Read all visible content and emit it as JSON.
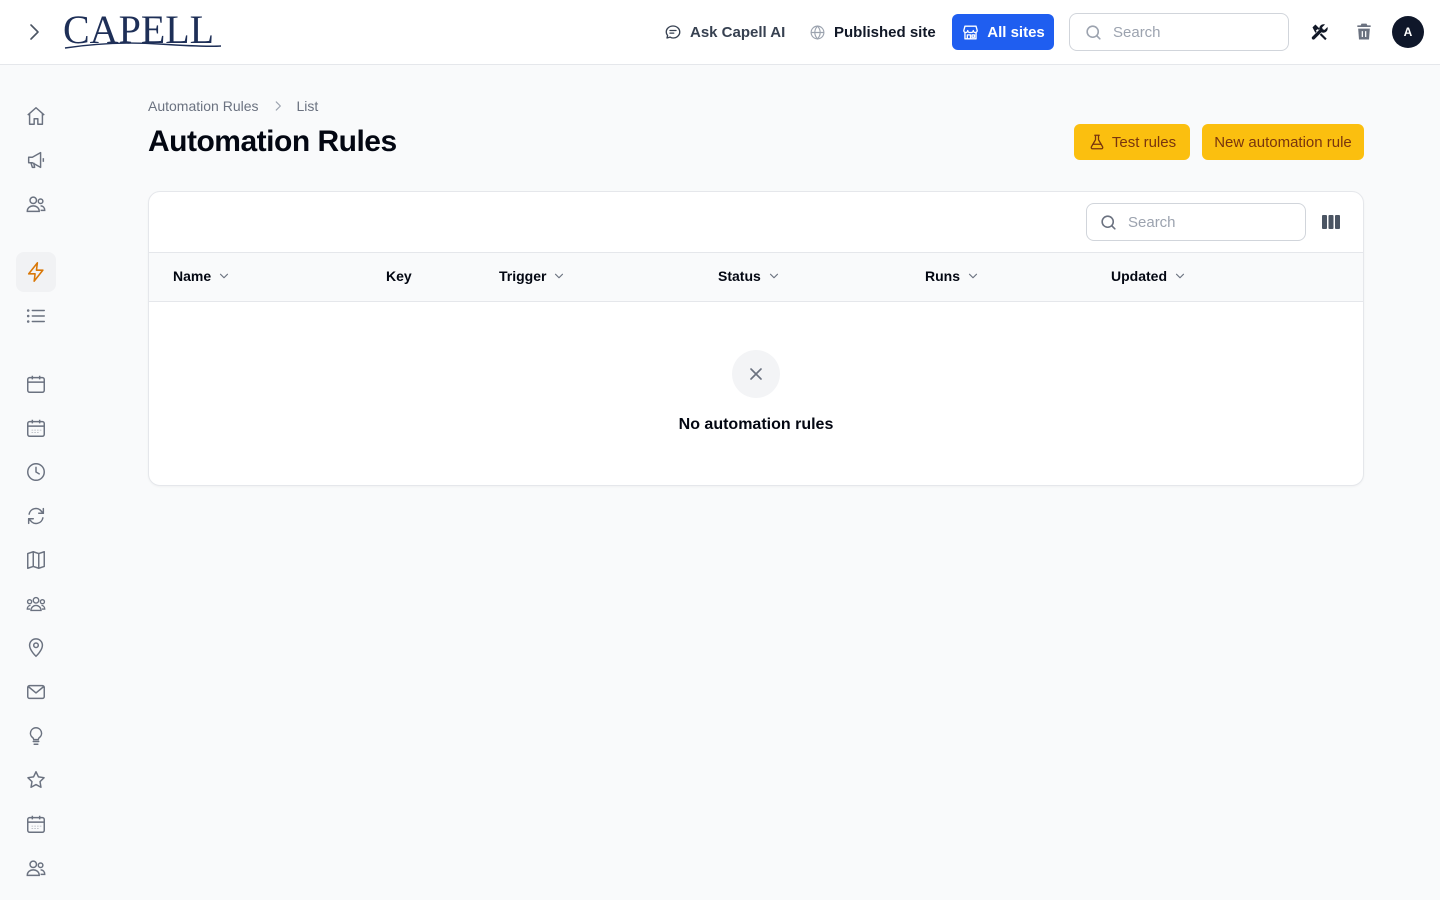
{
  "header": {
    "brand": "CAPELL",
    "ask_ai_label": "Ask Capell AI",
    "published_label": "Published site",
    "all_sites_label": "All sites",
    "search_placeholder": "Search",
    "avatar_initial": "A"
  },
  "sidebar": {
    "items": [
      {
        "icon": "home-icon"
      },
      {
        "icon": "megaphone-icon"
      },
      {
        "icon": "users-icon"
      },
      {
        "icon": "bolt-icon",
        "active": true
      },
      {
        "icon": "list-icon"
      },
      {
        "icon": "calendar-icon"
      },
      {
        "icon": "calendar-days-icon"
      },
      {
        "icon": "clock-icon"
      },
      {
        "icon": "refresh-icon"
      },
      {
        "icon": "map-icon"
      },
      {
        "icon": "user-group-icon"
      },
      {
        "icon": "map-pin-icon"
      },
      {
        "icon": "envelope-icon"
      },
      {
        "icon": "light-bulb-icon"
      },
      {
        "icon": "star-icon"
      },
      {
        "icon": "calendar-days-icon"
      },
      {
        "icon": "users-icon"
      }
    ]
  },
  "breadcrumb": {
    "items": [
      "Automation Rules",
      "List"
    ]
  },
  "page": {
    "title": "Automation Rules",
    "test_rules_label": "Test rules",
    "new_rule_label": "New automation rule"
  },
  "table": {
    "search_placeholder": "Search",
    "columns": [
      {
        "label": "Name",
        "sortable": true
      },
      {
        "label": "Key",
        "sortable": false
      },
      {
        "label": "Trigger",
        "sortable": true
      },
      {
        "label": "Status",
        "sortable": true
      },
      {
        "label": "Runs",
        "sortable": true
      },
      {
        "label": "Updated",
        "sortable": true
      }
    ],
    "rows": [],
    "empty_message": "No automation rules"
  },
  "colors": {
    "primary": "#1f5ef0",
    "accent": "#fbbf0f",
    "active_icon": "#d97706",
    "brand": "#1e2f57"
  }
}
